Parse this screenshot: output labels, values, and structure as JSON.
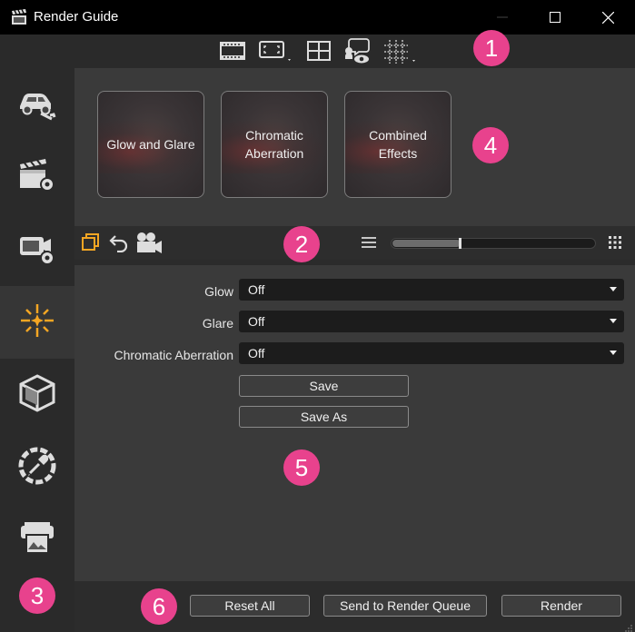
{
  "app": {
    "title": "Render Guide"
  },
  "toolbar": {
    "icons": [
      "film-strip-icon",
      "frame-select-icon",
      "layout-grid-icon",
      "speech-bubble-eye-icon",
      "guides-grid-icon"
    ]
  },
  "sidebar": {
    "items": [
      {
        "name": "car-wrench-icon",
        "active": false
      },
      {
        "name": "clapper-settings-icon",
        "active": false
      },
      {
        "name": "camera-settings-icon",
        "active": false
      },
      {
        "name": "sparkle-effects-icon",
        "active": true
      },
      {
        "name": "cube-environment-icon",
        "active": false
      },
      {
        "name": "eyedropper-color-icon",
        "active": false
      },
      {
        "name": "printer-output-icon",
        "active": false
      }
    ]
  },
  "presets": [
    {
      "label": "Glow and Glare"
    },
    {
      "label": "Chromatic Aberration"
    },
    {
      "label": "Combined Effects"
    }
  ],
  "subtoolbar": {
    "slider_value_pct": 34
  },
  "fields": [
    {
      "label": "Glow",
      "value": "Off"
    },
    {
      "label": "Glare",
      "value": "Off"
    },
    {
      "label": "Chromatic Aberration",
      "value": "Off"
    }
  ],
  "actions": {
    "save": "Save",
    "save_as": "Save As"
  },
  "footer": {
    "reset_all": "Reset All",
    "send_queue": "Send to Render Queue",
    "render": "Render"
  },
  "callouts": [
    "1",
    "2",
    "3",
    "4",
    "5",
    "6"
  ],
  "colors": {
    "accent_orange": "#f5a623",
    "callout_pink": "#e8428d"
  }
}
